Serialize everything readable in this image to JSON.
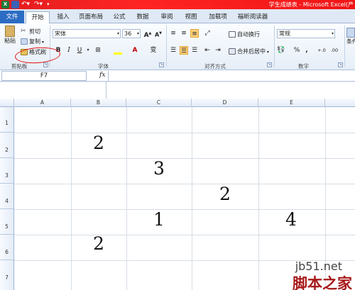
{
  "window": {
    "title": "学生成绩表 - Microsoft Excel(产",
    "app_icon": "X",
    "qa_icons": [
      "save-icon",
      "undo-icon",
      "redo-icon",
      "dropdown-icon"
    ]
  },
  "tabs": [
    "文件",
    "开始",
    "插入",
    "页面布局",
    "公式",
    "数据",
    "审阅",
    "视图",
    "加载项",
    "福昕阅读器"
  ],
  "ribbon": {
    "clipboard": {
      "paste": "粘贴",
      "cut": "剪切",
      "copy": "复制",
      "format_painter": "格式刷",
      "label": "剪贴板"
    },
    "font": {
      "name": "宋体",
      "size": "36",
      "grow": "A",
      "shrink": "A",
      "bold": "B",
      "italic": "I",
      "underline": "U",
      "phonetic": "变",
      "label": "字体"
    },
    "alignment": {
      "wrap": "自动换行",
      "merge": "合并后居中",
      "label": "对齐方式"
    },
    "number": {
      "format": "常规",
      "percent": "%",
      "comma": ",",
      "inc_decimal": "+.0",
      "dec_decimal": ".00",
      "label": "数字"
    },
    "styles": {
      "conditional": "条件格"
    }
  },
  "formula_bar": {
    "name_box": "F7",
    "fx": "fx",
    "value": ""
  },
  "sheet": {
    "columns": [
      "A",
      "B",
      "C",
      "D",
      "E"
    ],
    "rows": [
      "1",
      "2",
      "3",
      "4",
      "5",
      "6",
      "7"
    ],
    "cells": {
      "B2": "2",
      "C3": "3",
      "D4": "2",
      "C5": "1",
      "E5": "4",
      "B6": "2"
    }
  },
  "watermark": {
    "site": "jb51.net",
    "brand": "脚本之家"
  },
  "colors": {
    "title_bar": "#ff2424",
    "file_tab": "#2c6cc3",
    "annotation": "#e01010",
    "watermark_brand": "#a7191a"
  }
}
